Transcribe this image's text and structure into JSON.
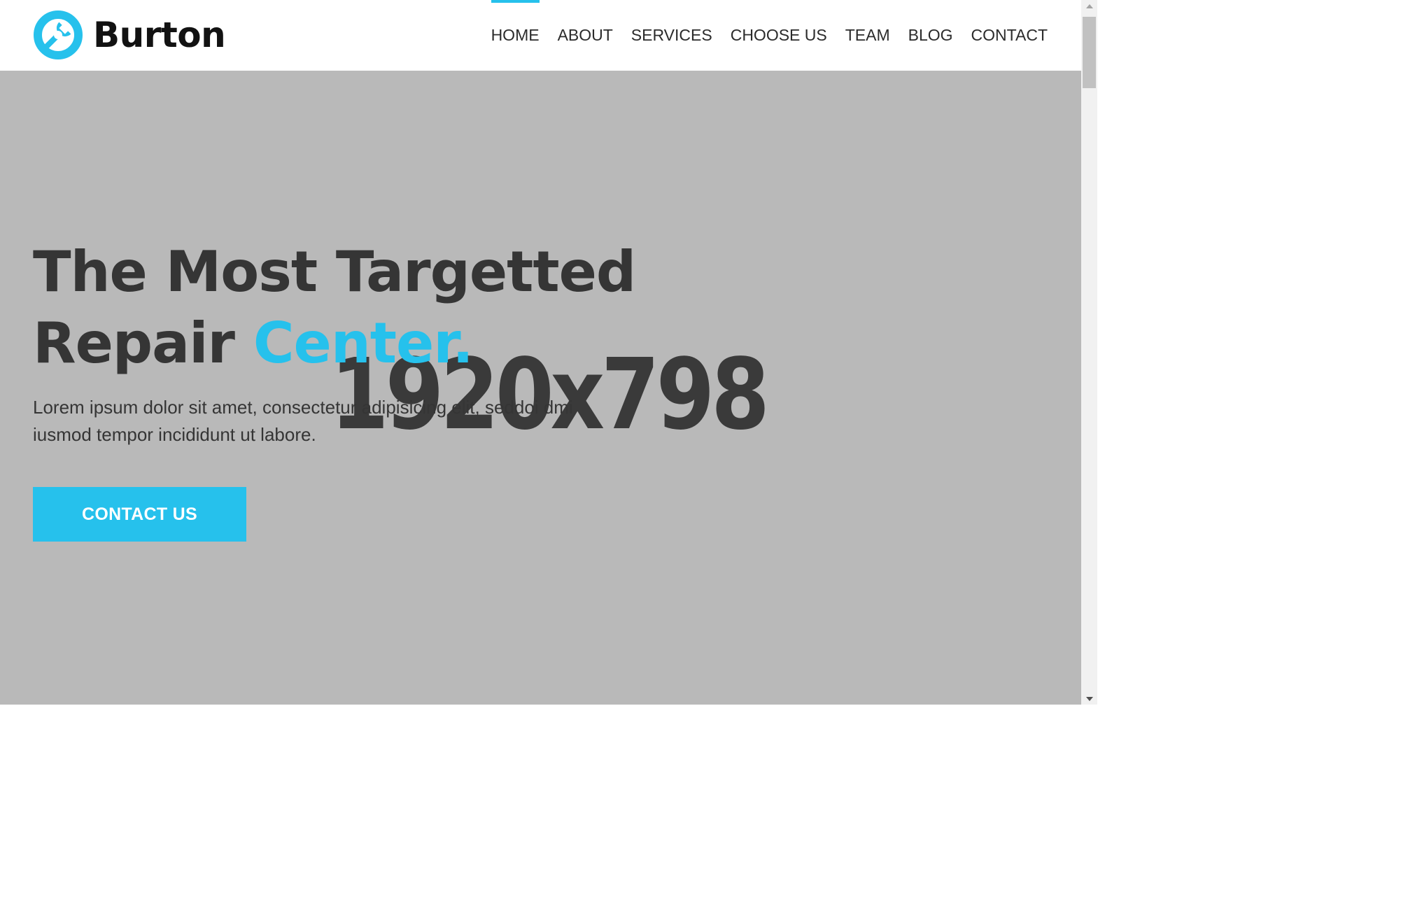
{
  "colors": {
    "accent": "#26c1ec",
    "heading": "#353535",
    "hero_background": "#b9b9b9",
    "header_background": "#ffffff"
  },
  "brand": {
    "name": "Burton",
    "logo_icon": "wrench-circle-icon"
  },
  "nav": {
    "items": [
      {
        "label": "HOME",
        "active": true
      },
      {
        "label": "ABOUT",
        "active": false
      },
      {
        "label": "SERVICES",
        "active": false
      },
      {
        "label": "CHOOSE US",
        "active": false
      },
      {
        "label": "TEAM",
        "active": false
      },
      {
        "label": "BLOG",
        "active": false
      },
      {
        "label": "CONTACT",
        "active": false
      }
    ]
  },
  "hero": {
    "placeholder_label": "1920x798",
    "title_line1": "The Most Targetted",
    "title_line2_prefix": "Repair",
    "title_line2_accent": "Center.",
    "description": "Lorem ipsum dolor sit amet, consectetur adipisicing elit, seddoi dmi iusmod tempor incididunt ut labore.",
    "cta_label": "CONTACT US"
  }
}
